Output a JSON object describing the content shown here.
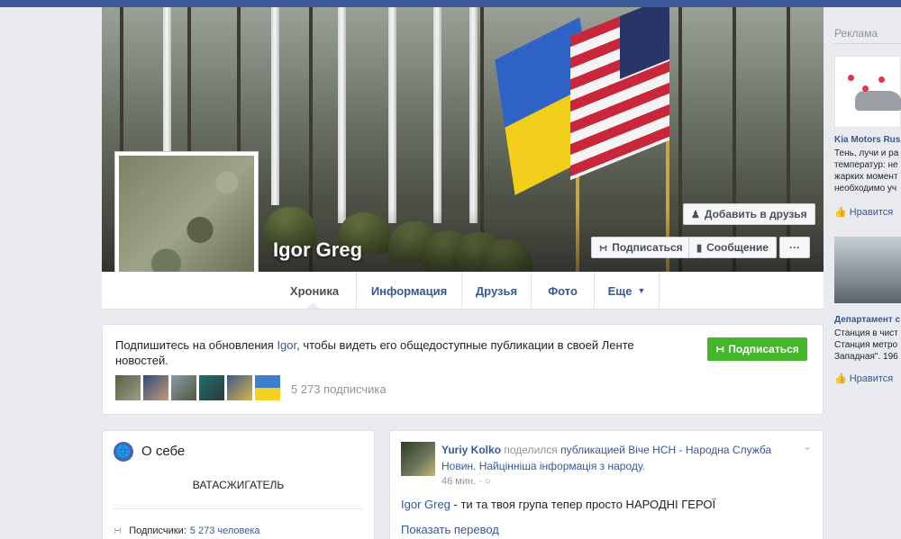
{
  "profile": {
    "name": "Igor Greg",
    "add_friend": "Добавить в друзья",
    "follow": "Подписаться",
    "message": "Сообщение",
    "more": "···"
  },
  "tabs": [
    {
      "label": "Хроника"
    },
    {
      "label": "Информация"
    },
    {
      "label": "Друзья"
    },
    {
      "label": "Фото"
    },
    {
      "label": "Еще"
    }
  ],
  "subscribe_box": {
    "text_before": "Подпишитесь на обновления",
    "link_name": "Igor",
    "text_after": ", чтобы видеть его общедоступные публикации в своей Ленте новостей.",
    "button": "Подписаться",
    "count": "5 273 подписчика"
  },
  "about": {
    "title": "О себе",
    "job": "ВАТАСЖИГАТЕЛЬ",
    "subscribers_label": "Подписчики:",
    "subscribers_link": "5 273 человека"
  },
  "post": {
    "author": "Yuriy Kolko",
    "shared": "поделился",
    "shared_link": "публикацией Віче НСН - Народна Служба Новин. Найцінніша інформація з народу.",
    "time": "46 мин. ·",
    "mention": "Igor Greg",
    "body": " - ти та твоя група тепер просто НАРОДНІ ГЕРОЇ",
    "translate": "Показать перевод"
  },
  "rail": {
    "header": "Реклама",
    "ads": [
      {
        "title": "Kia Motors Rus",
        "lines": [
          "Тень, лучи и ра",
          "температур: не",
          "жарких момент",
          "необходимо уч"
        ],
        "like": "Нравится"
      },
      {
        "title": "Департамент с",
        "lines": [
          "Станция в чист",
          "Станция метро",
          "Западная\". 196"
        ],
        "like": "Нравится"
      }
    ]
  },
  "colors": {
    "link": "#365899",
    "topbar": "#3b5998",
    "green": "#42b72a"
  }
}
